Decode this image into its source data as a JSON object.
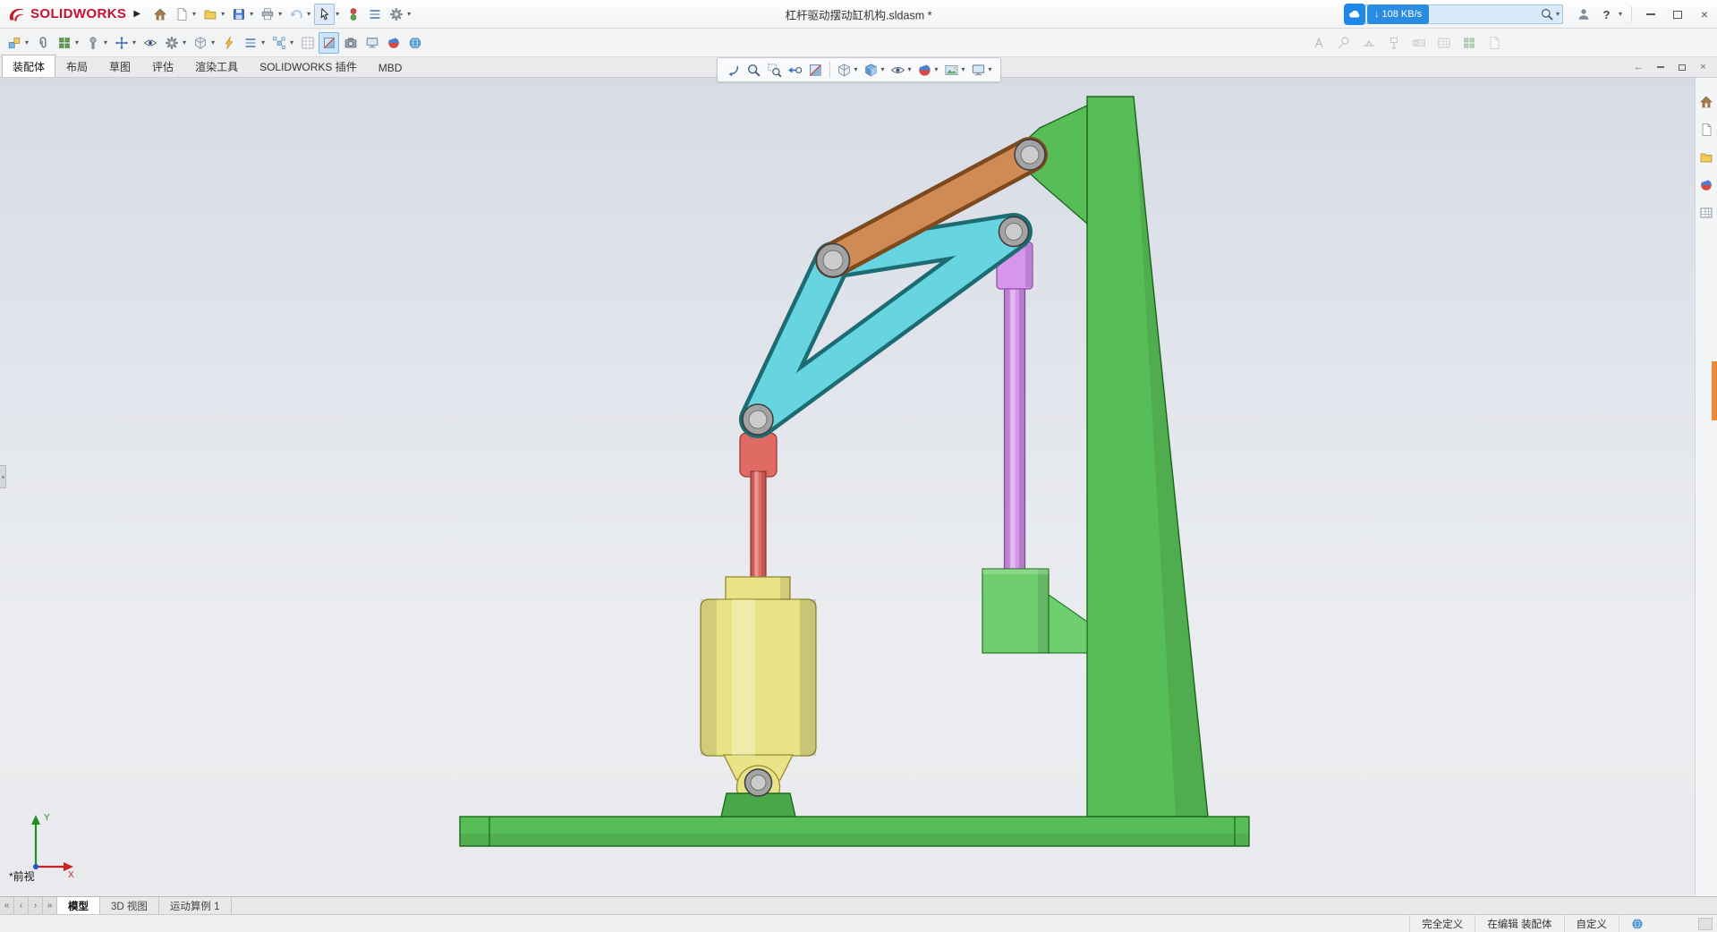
{
  "window": {
    "brand": "SOLIDWORKS",
    "title": "杠杆驱动摆动缸机构.sldasm *",
    "upload_chip": "108 KB/s"
  },
  "icons": {
    "caret": "▾",
    "flyout_arrow": "▶",
    "download_arrow": "↓",
    "help": "?",
    "close": "×",
    "dock_arrow": "←",
    "nav_first": "«",
    "nav_prev": "‹",
    "nav_next": "›",
    "nav_last": "»"
  },
  "ribbon_tabs": [
    {
      "label": "装配体",
      "active": true
    },
    {
      "label": "布局",
      "active": false
    },
    {
      "label": "草图",
      "active": false
    },
    {
      "label": "评估",
      "active": false
    },
    {
      "label": "渲染工具",
      "active": false
    },
    {
      "label": "SOLIDWORKS 插件",
      "active": false
    },
    {
      "label": "MBD",
      "active": false
    }
  ],
  "viewport": {
    "view_label": "*前视",
    "triad_x": "X",
    "triad_y": "Y"
  },
  "bottom_tabs": [
    {
      "label": "模型",
      "active": true
    },
    {
      "label": "3D 视图",
      "active": false
    },
    {
      "label": "运动算例 1",
      "active": false
    }
  ],
  "statusbar": {
    "fully_defined": "完全定义",
    "editing": "在编辑 装配体",
    "custom": "自定义"
  },
  "scene": {
    "colors": {
      "frame_green": "#57bd57",
      "block_green": "#6fcf6f",
      "clevis_green": "#48a848",
      "cylinder_yellow": "#e9e388",
      "rod_red": "#e06a64",
      "link_orange": "#d08b54",
      "crank_cyan": "#67d5df",
      "swing_purple": "#d795ec",
      "pin_gray": "#a3a3a3",
      "pin_core": "#cccccc"
    }
  }
}
